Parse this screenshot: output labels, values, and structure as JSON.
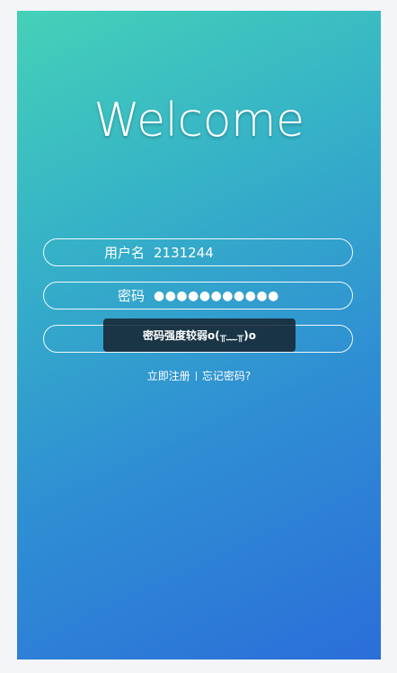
{
  "welcome": {
    "title": "Welcome"
  },
  "username": {
    "label": "用户名",
    "value": "2131244"
  },
  "password": {
    "label": "密码",
    "value": "●●●●●●●●●●●"
  },
  "toast": {
    "message": "密码强度较弱o(╥﹏╥)o"
  },
  "links": {
    "register": "立即注册",
    "forgot": "忘记密码?"
  },
  "colors": {
    "gradient_start": "#45d1b7",
    "gradient_end": "#2b6ed9"
  }
}
